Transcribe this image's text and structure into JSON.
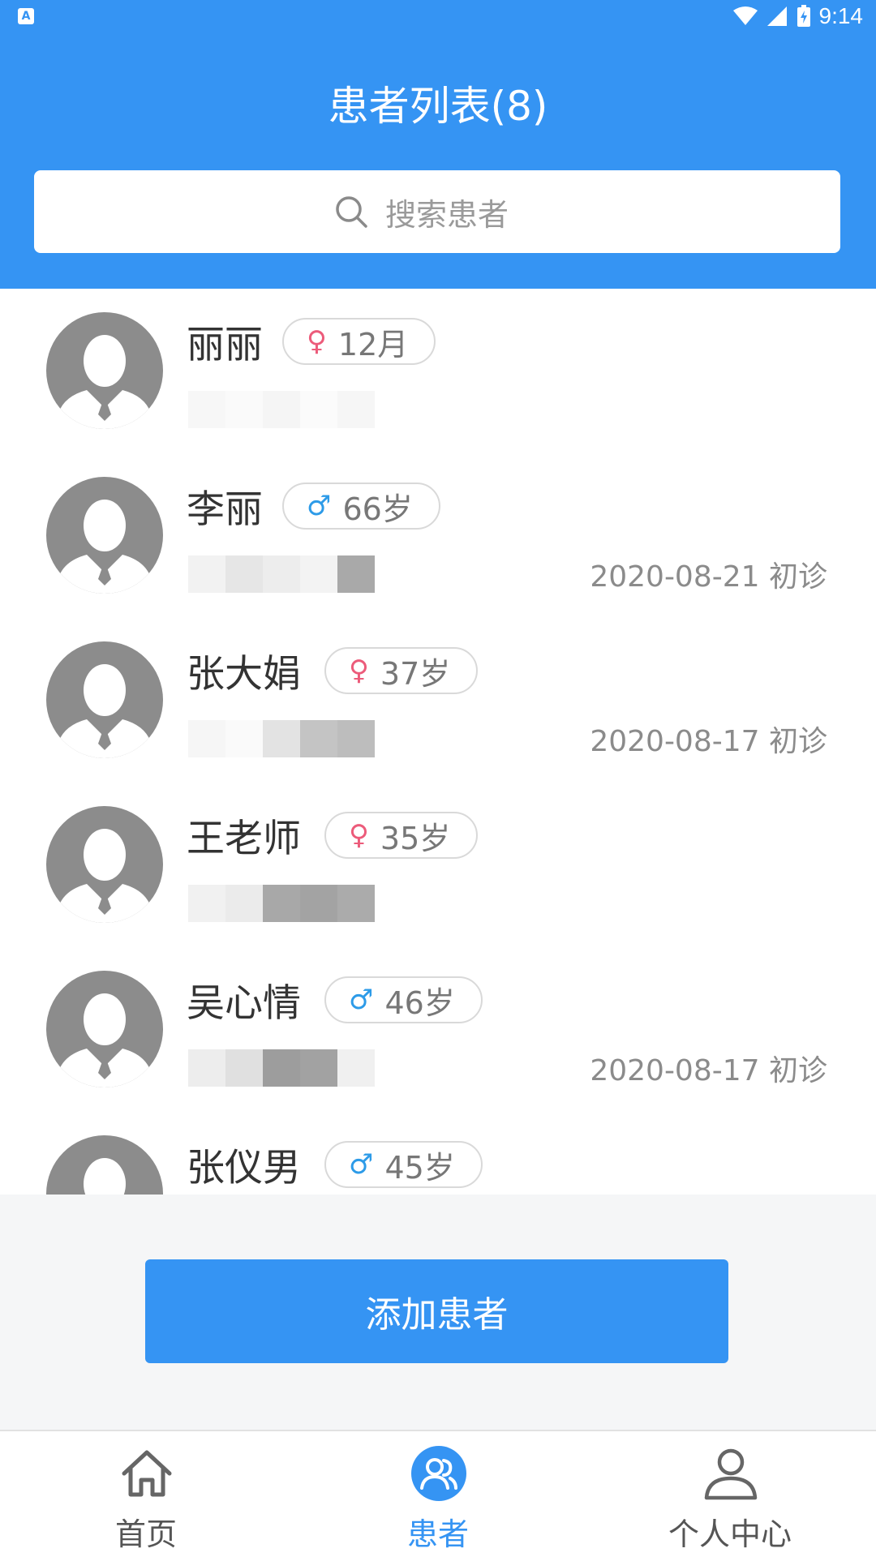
{
  "status_bar": {
    "time": "9:14"
  },
  "header": {
    "title": "患者列表(8)"
  },
  "search": {
    "placeholder": "搜索患者"
  },
  "patients": [
    {
      "name": "丽丽",
      "gender": "female",
      "gender_symbol": "♀",
      "age": "12月",
      "visit": ""
    },
    {
      "name": "李丽",
      "gender": "male",
      "gender_symbol": "♂",
      "age": "66岁",
      "visit": "2020-08-21 初诊"
    },
    {
      "name": "张大娟",
      "gender": "female",
      "gender_symbol": "♀",
      "age": "37岁",
      "visit": "2020-08-17 初诊"
    },
    {
      "name": "王老师",
      "gender": "female",
      "gender_symbol": "♀",
      "age": "35岁",
      "visit": ""
    },
    {
      "name": "吴心情",
      "gender": "male",
      "gender_symbol": "♂",
      "age": "46岁",
      "visit": "2020-08-17 初诊"
    },
    {
      "name": "张仪男",
      "gender": "male",
      "gender_symbol": "♂",
      "age": "45岁",
      "visit": ""
    }
  ],
  "add_button": {
    "label": "添加患者"
  },
  "tabs": [
    {
      "label": "首页",
      "icon": "home-icon",
      "active": false
    },
    {
      "label": "患者",
      "icon": "patients-icon",
      "active": true
    },
    {
      "label": "个人中心",
      "icon": "person-icon",
      "active": false
    }
  ],
  "colors": {
    "primary": "#3594f3",
    "female": "#ec5b7a",
    "male": "#2d9be8"
  }
}
